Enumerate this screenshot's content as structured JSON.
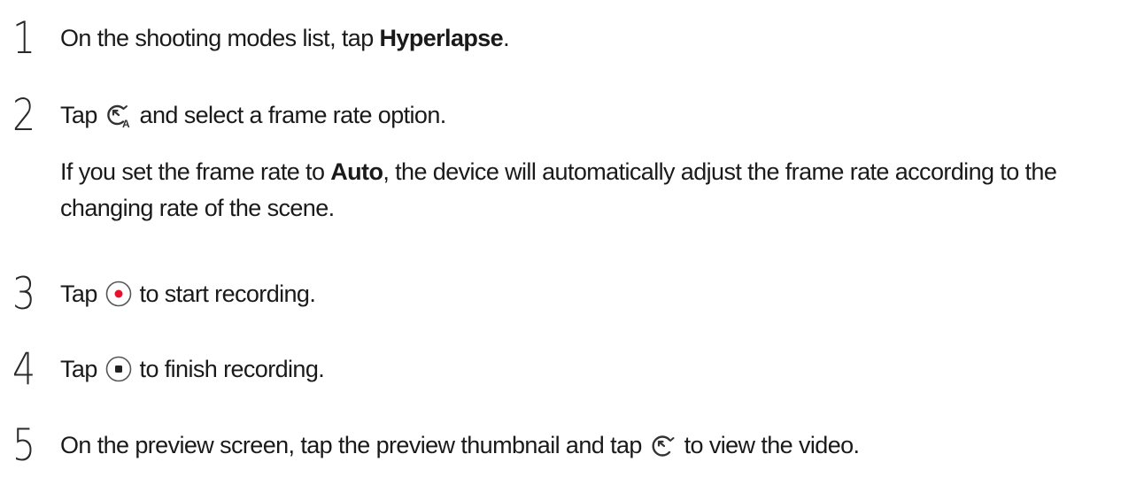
{
  "steps": [
    {
      "number": "1",
      "before": "On the shooting modes list, tap ",
      "bold": "Hyperlapse",
      "after": "."
    },
    {
      "number": "2",
      "before": "Tap ",
      "icon": "hyperlapse-auto-frame-rate-icon",
      "after": " and select a frame rate option.",
      "note": {
        "before": "If you set the frame rate to ",
        "bold": "Auto",
        "after": ", the device will automatically adjust the frame rate according to the changing rate of the scene."
      }
    },
    {
      "number": "3",
      "before": "Tap ",
      "icon": "record-icon",
      "after": " to start recording."
    },
    {
      "number": "4",
      "before": "Tap ",
      "icon": "stop-icon",
      "after": " to finish recording."
    },
    {
      "number": "5",
      "before": "On the preview screen, tap the preview thumbnail and tap ",
      "icon": "play-hyperlapse-icon",
      "after": " to view the video."
    }
  ],
  "colors": {
    "text": "#1a1a1a",
    "record_red": "#e8112d",
    "icon_stroke": "#333333"
  }
}
